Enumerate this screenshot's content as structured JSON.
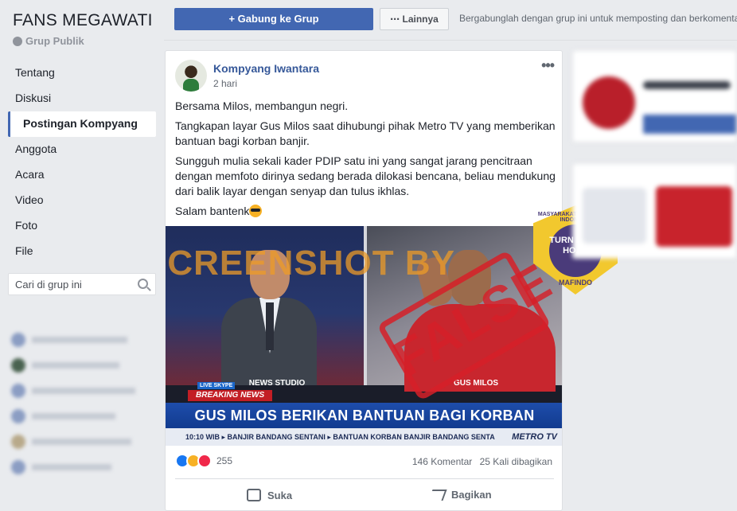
{
  "group": {
    "title": "FANS MEGAWATI",
    "type": "Grup Publik"
  },
  "sidebar": {
    "items": [
      {
        "label": "Tentang"
      },
      {
        "label": "Diskusi"
      },
      {
        "label": "Postingan Kompyang",
        "active": true
      },
      {
        "label": "Anggota"
      },
      {
        "label": "Acara"
      },
      {
        "label": "Video"
      },
      {
        "label": "Foto"
      },
      {
        "label": "File"
      }
    ],
    "search_placeholder": "Cari di grup ini"
  },
  "topbar": {
    "join_label": "+ Gabung ke Grup",
    "more_label": "⋯ Lainnya",
    "note": "Bergabunglah dengan grup ini untuk memposting dan berkomentar."
  },
  "post": {
    "author": "Kompyang Iwantara",
    "time": "2 hari",
    "paragraphs": [
      "Bersama Milos, membangun negri.",
      "Tangkapan layar Gus Milos saat dihubungi pihak Metro TV yang memberikan bantuan bagi korban banjir.",
      "Sungguh mulia sekali kader PDIP satu ini yang sangat jarang pencitraan dengan memfoto dirinya sedang berada dilokasi bencana, beliau mendukung dari balik layar dengan senyap dan tulus ikhlas.",
      "Salam bantenk"
    ],
    "image": {
      "left_label": "NEWS STUDIO",
      "right_label": "GUS MILOS",
      "live_tag": "LIVE SKYPE",
      "breaking": "BREAKING NEWS",
      "headline": "GUS MILOS BERIKAN BANTUAN BAGI KORBAN BANJIR",
      "ticker": "10:10 WIB ▸ BANJIR BANDANG SENTANI ▸ BANTUAN KORBAN BANJIR BANDANG SENTA",
      "channel": "METRO TV",
      "watermark": "SCREENSHOT BY",
      "stamp": "FALSE",
      "badge_top": "MASYARAKAT ANTI FITNAH INDONESIA",
      "badge_center": "TURN BACK HOAX",
      "badge_bottom": "MAFINDO"
    },
    "reactions_count": "255",
    "comments": "146 Komentar",
    "shares": "25 Kali dibagikan",
    "like_label": "Suka",
    "share_label": "Bagikan"
  },
  "colors": {
    "brand": "#4267b2",
    "link": "#365899",
    "stamp_red": "#d62028",
    "watermark_orange": "#ec9b28"
  }
}
